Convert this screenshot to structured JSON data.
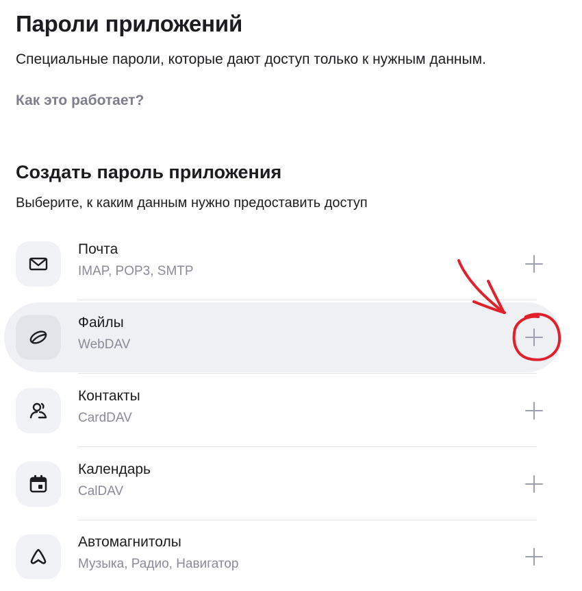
{
  "header": {
    "title": "Пароли приложений",
    "description": "Специальные пароли, которые дают доступ только к нужным данным.",
    "how_link": "Как это работает?"
  },
  "section": {
    "title": "Создать пароль приложения",
    "subtitle": "Выберите, к каким данным нужно предоставить доступ"
  },
  "items": [
    {
      "title": "Почта",
      "subtitle": "IMAP, POP3, SMTP",
      "icon": "mail-icon"
    },
    {
      "title": "Файлы",
      "subtitle": "WebDAV",
      "icon": "disk-icon"
    },
    {
      "title": "Контакты",
      "subtitle": "CardDAV",
      "icon": "contacts-icon"
    },
    {
      "title": "Календарь",
      "subtitle": "CalDAV",
      "icon": "calendar-icon"
    },
    {
      "title": "Автомагнитолы",
      "subtitle": "Музыка, Радио, Навигатор",
      "icon": "car-radio-icon"
    }
  ],
  "colors": {
    "hover_background": "#eff0f4",
    "plus_icon": "#9c9fb0",
    "annotation": "#e0202a"
  }
}
